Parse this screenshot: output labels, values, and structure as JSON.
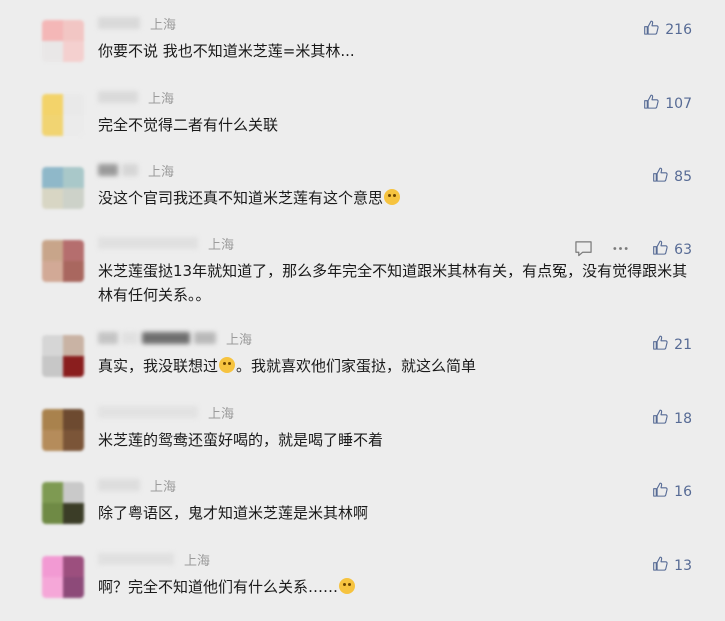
{
  "comments": [
    {
      "location": "上海",
      "segments": [
        {
          "t": "你要不说 我也不知道米芝莲=米其林..."
        }
      ],
      "likes": "216",
      "avatar_colors": [
        "#f4b7b7",
        "#f2c6c4",
        "#e9e7e7",
        "#f4d0cf"
      ],
      "nick_blur": [
        {
          "w": 42,
          "c": "#d9d9d9"
        }
      ]
    },
    {
      "location": "上海",
      "segments": [
        {
          "t": "完全不觉得二者有什么关联"
        }
      ],
      "likes": "107",
      "avatar_colors": [
        "#f3d36a",
        "#e9e9e9",
        "#f1d472",
        "#ebebeb"
      ],
      "nick_blur": [
        {
          "w": 40,
          "c": "#dadada"
        }
      ]
    },
    {
      "location": "上海",
      "segments": [
        {
          "t": "没这个官司我还真不知道米芝莲有这个意思"
        },
        {
          "emoji": "blush-emoji"
        }
      ],
      "likes": "85",
      "avatar_colors": [
        "#8fb8c9",
        "#a9c8c9",
        "#d8d6c4",
        "#cdd2c9"
      ],
      "nick_blur": [
        {
          "w": 20,
          "c": "#9a9a9a"
        },
        {
          "w": 16,
          "c": "#d6d6d6"
        }
      ]
    },
    {
      "location": "上海",
      "segments": [
        {
          "t": "米芝莲蛋挞13年就知道了，那么多年完全不知道跟米其林有关，有点冤，没有觉得跟米其林有任何关系。。"
        }
      ],
      "likes": "63",
      "tools": true,
      "avatar_colors": [
        "#c8a58a",
        "#b56e6e",
        "#d2a996",
        "#a9675f"
      ],
      "nick_blur": [
        {
          "w": 100,
          "c": "#e0e0e0"
        }
      ]
    },
    {
      "location": "上海",
      "segments": [
        {
          "t": "真实，我没联想过"
        },
        {
          "emoji": "smiling-emoji"
        },
        {
          "t": "。我就喜欢他们家蛋挞，就这么简单"
        }
      ],
      "likes": "21",
      "avatar_colors": [
        "#d6d6d6",
        "#c9b3a4",
        "#c7c7c7",
        "#8a1e1e"
      ],
      "nick_blur": [
        {
          "w": 20,
          "c": "#c4c4c4"
        },
        {
          "w": 16,
          "c": "#e0e0e0"
        },
        {
          "w": 48,
          "c": "#6f6f6f"
        },
        {
          "w": 22,
          "c": "#b9b9b9"
        }
      ]
    },
    {
      "location": "上海",
      "segments": [
        {
          "t": "米芝莲的鸳鸯还蛮好喝的，就是喝了睡不着"
        }
      ],
      "likes": "18",
      "avatar_colors": [
        "#a9824d",
        "#6d4a30",
        "#b58c5b",
        "#7b5538"
      ],
      "nick_blur": [
        {
          "w": 100,
          "c": "#e2e2e2"
        }
      ]
    },
    {
      "location": "上海",
      "segments": [
        {
          "t": "除了粤语区，鬼才知道米芝莲是米其林啊"
        }
      ],
      "likes": "16",
      "avatar_colors": [
        "#7e9a52",
        "#c9c9c9",
        "#6f8a45",
        "#3b3d27"
      ],
      "nick_blur": [
        {
          "w": 42,
          "c": "#dddddd"
        }
      ]
    },
    {
      "location": "上海",
      "segments": [
        {
          "t": "啊？完全不知道他们有什么关系……"
        },
        {
          "emoji": "sad-emoji"
        }
      ],
      "likes": "13",
      "avatar_colors": [
        "#f29ad3",
        "#9c4f7e",
        "#f5a7d8",
        "#8d4a79"
      ],
      "nick_blur": [
        {
          "w": 76,
          "c": "#e0e0e0"
        }
      ]
    }
  ]
}
